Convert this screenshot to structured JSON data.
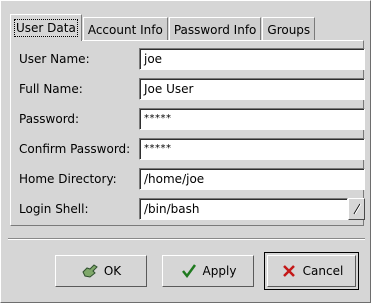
{
  "tabs": [
    {
      "label": "User Data"
    },
    {
      "label": "Account Info"
    },
    {
      "label": "Password Info"
    },
    {
      "label": "Groups"
    }
  ],
  "fields": {
    "user_name": {
      "label": "User Name:",
      "value": "joe"
    },
    "full_name": {
      "label": "Full Name:",
      "value": "Joe User"
    },
    "password": {
      "label": "Password:",
      "value": "*****"
    },
    "confirm_password": {
      "label": "Confirm Password:",
      "value": "*****"
    },
    "home_directory": {
      "label": "Home Directory:",
      "value": "/home/joe"
    },
    "login_shell": {
      "label": "Login Shell:",
      "value": "/bin/bash"
    }
  },
  "buttons": {
    "ok": "OK",
    "apply": "Apply",
    "cancel": "Cancel"
  },
  "icons": {
    "ok": "ok-hand-icon",
    "apply": "checkmark-icon",
    "cancel": "cross-icon",
    "combo": "dropdown-arrow-icon"
  },
  "colors": {
    "background": "#d6d6d6",
    "entry": "#ffffff",
    "apply_check": "#1f7a1f",
    "cancel_x": "#c41818",
    "ok_hand": "#7fa86a"
  }
}
